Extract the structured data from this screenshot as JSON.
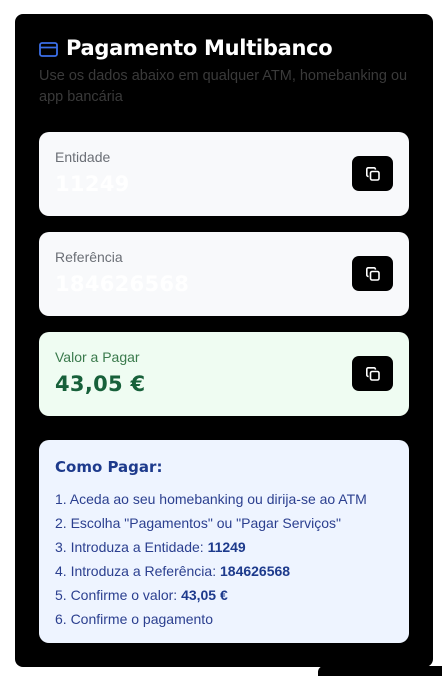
{
  "header": {
    "icon": "credit-card-icon",
    "title": "Pagamento Multibanco",
    "subtitle": "Use os dados abaixo em qualquer ATM, homebanking ou app bancária"
  },
  "fields": [
    {
      "label": "Entidade",
      "value": "11249",
      "copy_icon": "copy-icon"
    },
    {
      "label": "Referência",
      "value": "184626568",
      "copy_icon": "copy-icon"
    },
    {
      "label": "Valor a Pagar",
      "value": "43,05 €",
      "copy_icon": "copy-icon"
    }
  ],
  "howto": {
    "title": "Como Pagar:",
    "steps": [
      {
        "text": "1. Aceda ao seu homebanking ou dirija-se ao ATM",
        "bold": ""
      },
      {
        "text": "2. Escolha \"Pagamentos\" ou \"Pagar Serviços\"",
        "bold": ""
      },
      {
        "text": "3. Introduza a Entidade: ",
        "bold": "11249"
      },
      {
        "text": "4. Introduza a Referência: ",
        "bold": "184626568"
      },
      {
        "text": "5. Confirme o valor: ",
        "bold": "43,05 €"
      },
      {
        "text": "6. Confirme o pagamento",
        "bold": ""
      }
    ]
  },
  "colors": {
    "panel_bg": "#000000",
    "field_bg": "#f8f9fb",
    "amount_bg": "#effcf2",
    "amount_text": "#17603a",
    "howto_bg": "#eef4ff",
    "howto_text": "#1d3a8c",
    "accent_icon": "#3b6fe8"
  }
}
